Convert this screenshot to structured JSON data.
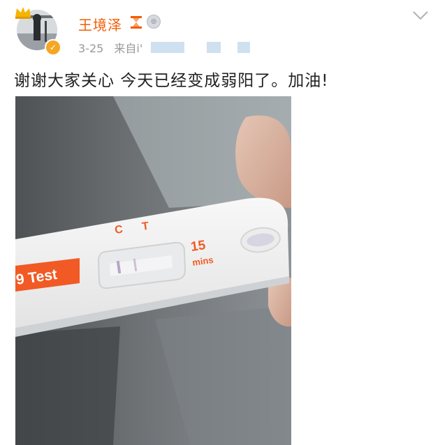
{
  "post": {
    "username": "王境泽",
    "date": "3-25",
    "source_prefix": "来自i'",
    "text": "谢谢大家关心 今天已经变成弱阳了。加油!"
  },
  "photo": {
    "test_label": "9 Test",
    "line_c": "C",
    "line_t": "T",
    "minutes_value": "15",
    "minutes_unit": "mins"
  },
  "icons": {
    "avatar": "avatar",
    "crown": "crown-icon",
    "verified": "verified-icon",
    "vip_badge": "hourglass-badge-icon",
    "medal_badge": "medal-badge-icon",
    "menu": "chevron-down-icon"
  },
  "colors": {
    "name": "#f25c05",
    "meta": "#9a9a9a",
    "text": "#222222",
    "verified": "#f5a623"
  }
}
